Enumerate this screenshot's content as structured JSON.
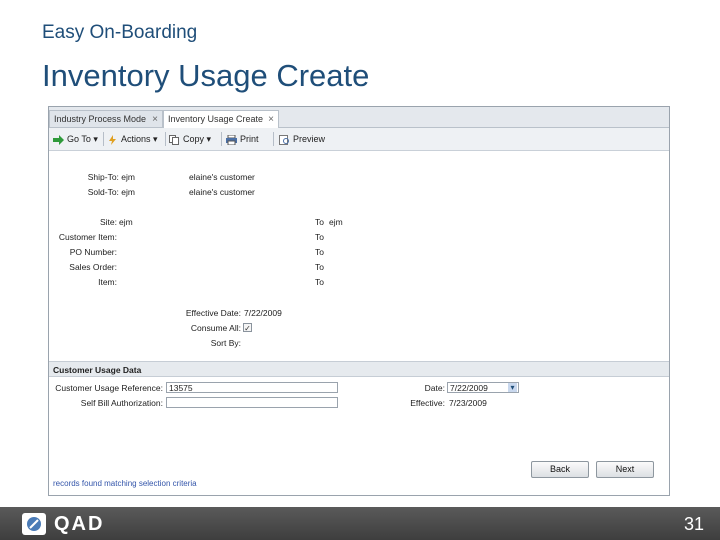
{
  "slide": {
    "subtitle": "Easy On-Boarding",
    "title": "Inventory Usage Create",
    "page_number": "31",
    "logo_text": "QAD"
  },
  "tabs": [
    {
      "label": "Industry Process Mode",
      "close": "×"
    },
    {
      "label": "Inventory Usage Create",
      "close": "×"
    }
  ],
  "toolbar": {
    "goto": "Go To",
    "actions": "Actions",
    "copy": "Copy",
    "print": "Print",
    "preview": "Preview",
    "colors": {
      "goto_icon": "#2e9a3a",
      "actions_icon": "#e0a020",
      "print_icon": "#4a6fa5"
    }
  },
  "header_info": {
    "ship_to_label": "Ship-To:",
    "ship_to_value": "ejm",
    "ship_to_name": "elaine's customer",
    "sold_to_label": "Sold-To:",
    "sold_to_value": "ejm",
    "sold_to_name": "elaine's customer"
  },
  "filters": {
    "site_label": "Site:",
    "site_from": "ejm",
    "site_to_label": "To",
    "site_to": "ejm",
    "customer_item_label": "Customer Item:",
    "customer_item_to_label": "To",
    "po_number_label": "PO Number:",
    "po_number_to_label": "To",
    "sales_order_label": "Sales Order:",
    "sales_order_to_label": "To",
    "item_label": "Item:",
    "item_to_label": "To"
  },
  "options": {
    "effective_date_label": "Effective Date:",
    "effective_date_value": "7/22/2009",
    "consume_all_label": "Consume All:",
    "consume_all_checked": "✓",
    "sort_by_label": "Sort By:"
  },
  "usage": {
    "section_title": "Customer Usage Data",
    "reference_label": "Customer Usage Reference:",
    "reference_value": "13575",
    "self_bill_label": "Self Bill Authorization:",
    "self_bill_value": "",
    "date_label": "Date:",
    "date_value": "7/22/2009",
    "effective_label": "Effective:",
    "effective_value": "7/23/2009"
  },
  "buttons": {
    "back": "Back",
    "next": "Next"
  },
  "status_text": "records found matching selection criteria"
}
